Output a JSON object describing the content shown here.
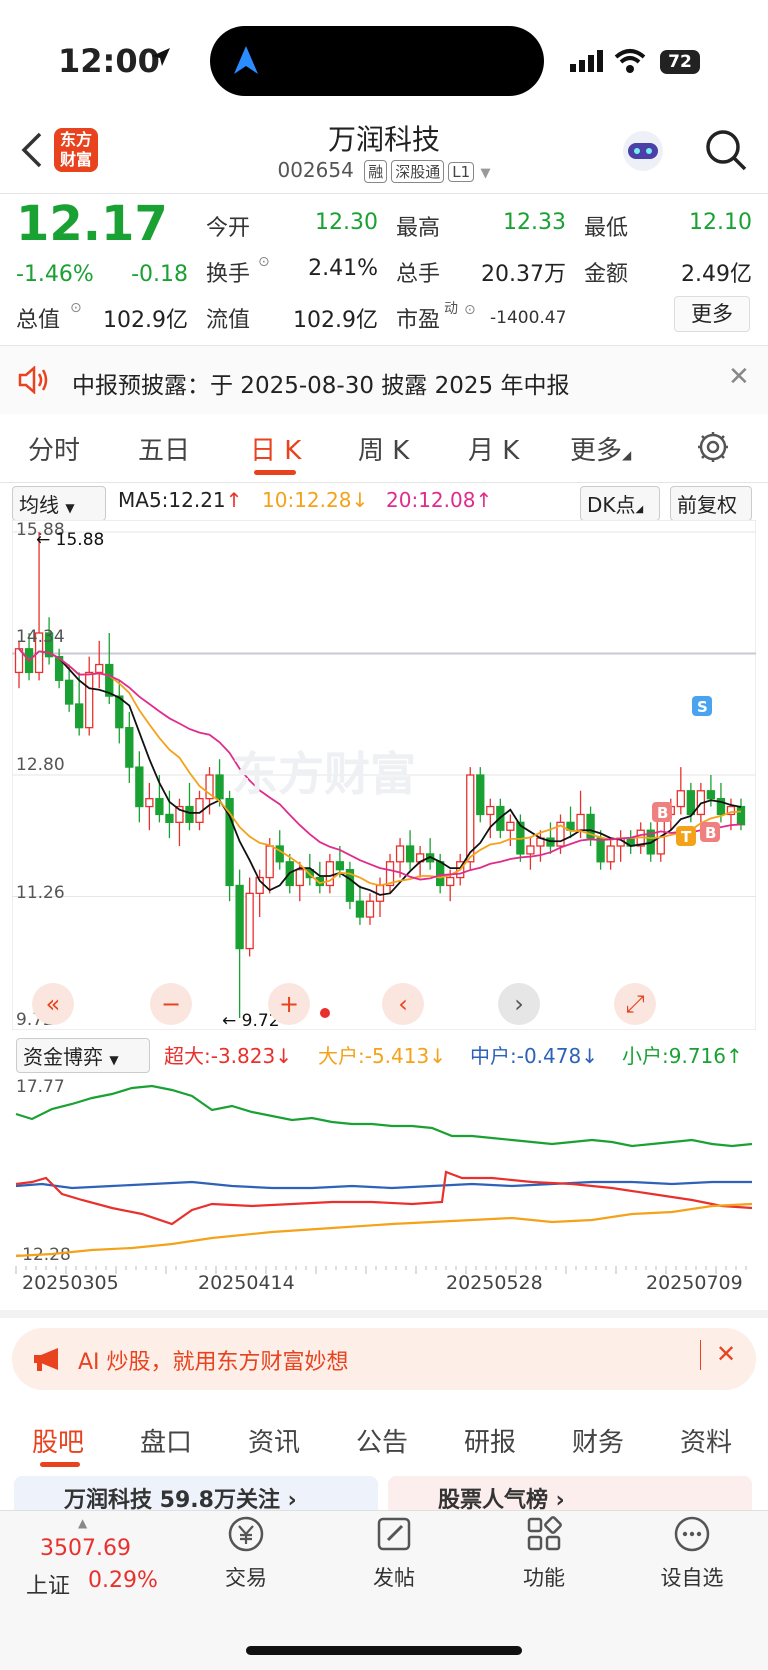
{
  "status_bar": {
    "time": "12:00",
    "battery": "72"
  },
  "header": {
    "logo_text": "东方\n财富",
    "title": "万润科技",
    "code": "002654",
    "tags": [
      "融",
      "深股通",
      "L1"
    ]
  },
  "quote": {
    "price": "12.17",
    "change_pct": "-1.46%",
    "change": "-0.18",
    "open_label": "今开",
    "open": "12.30",
    "high_label": "最高",
    "high": "12.33",
    "low_label": "最低",
    "low": "12.10",
    "turnover_label": "换手",
    "turnover": "2.41%",
    "volume_label": "总手",
    "volume": "20.37万",
    "amount_label": "金额",
    "amount": "2.49亿",
    "mktcap_label": "总值",
    "mktcap": "102.9亿",
    "float_label": "流值",
    "float": "102.9亿",
    "pe_label": "市盈",
    "pe_sup": "动",
    "pe": "-1400.47",
    "more_label": "更多"
  },
  "notice": {
    "text": "中报预披露：于 2025-08-30 披露 2025 年中报"
  },
  "period_tabs": [
    "分时",
    "五日",
    "日 K",
    "周 K",
    "月 K",
    "更多"
  ],
  "active_tab": "日 K",
  "chart_toolbar": {
    "ma_select": "均线",
    "ma5": "MA5:12.21",
    "ma10": "10:12.28",
    "ma20": "20:12.08",
    "dk_label": "DK点",
    "adjust_label": "前复权"
  },
  "chart_data": {
    "type": "candlestick",
    "y_labels": [
      "15.88",
      "14.34",
      "12.80",
      "11.26",
      "9.72"
    ],
    "max_label": "15.88",
    "min_label": "9.72",
    "ylim": [
      9.72,
      15.88
    ],
    "ma_colors": {
      "ma5": "#111111",
      "ma10": "#f4a21a",
      "ma20": "#e02b8d"
    },
    "markers": [
      "S",
      "B",
      "T",
      "B"
    ],
    "candles": [
      [
        14.1,
        14.5,
        13.9,
        14.4
      ],
      [
        14.4,
        14.6,
        14.0,
        14.1
      ],
      [
        14.1,
        15.88,
        14.0,
        14.6
      ],
      [
        14.6,
        14.8,
        14.2,
        14.3
      ],
      [
        14.3,
        14.4,
        13.9,
        14.0
      ],
      [
        14.0,
        14.2,
        13.6,
        13.7
      ],
      [
        13.7,
        14.1,
        13.3,
        13.4
      ],
      [
        13.4,
        14.3,
        13.3,
        14.1
      ],
      [
        14.1,
        14.5,
        13.9,
        14.2
      ],
      [
        14.2,
        14.6,
        13.7,
        13.8
      ],
      [
        13.8,
        14.0,
        13.2,
        13.4
      ],
      [
        13.4,
        13.6,
        12.7,
        12.9
      ],
      [
        12.9,
        13.1,
        12.2,
        12.4
      ],
      [
        12.4,
        12.7,
        12.1,
        12.5
      ],
      [
        12.5,
        12.8,
        12.2,
        12.3
      ],
      [
        12.3,
        12.6,
        12.0,
        12.2
      ],
      [
        12.2,
        12.5,
        11.9,
        12.4
      ],
      [
        12.4,
        12.7,
        12.1,
        12.2
      ],
      [
        12.2,
        12.6,
        12.1,
        12.5
      ],
      [
        12.5,
        12.9,
        12.3,
        12.8
      ],
      [
        12.8,
        13.0,
        12.4,
        12.5
      ],
      [
        12.5,
        12.6,
        11.2,
        11.4
      ],
      [
        11.4,
        11.6,
        9.72,
        10.6
      ],
      [
        10.6,
        11.5,
        10.5,
        11.3
      ],
      [
        11.3,
        11.6,
        11.0,
        11.5
      ],
      [
        11.5,
        12.0,
        11.3,
        11.9
      ],
      [
        11.9,
        12.1,
        11.6,
        11.7
      ],
      [
        11.7,
        11.8,
        11.3,
        11.4
      ],
      [
        11.4,
        11.7,
        11.2,
        11.6
      ],
      [
        11.6,
        11.8,
        11.4,
        11.5
      ],
      [
        11.5,
        11.7,
        11.3,
        11.4
      ],
      [
        11.4,
        11.8,
        11.3,
        11.7
      ],
      [
        11.7,
        11.9,
        11.5,
        11.6
      ],
      [
        11.6,
        11.7,
        11.1,
        11.2
      ],
      [
        11.2,
        11.4,
        10.9,
        11.0
      ],
      [
        11.0,
        11.3,
        10.9,
        11.2
      ],
      [
        11.2,
        11.5,
        11.0,
        11.4
      ],
      [
        11.4,
        11.8,
        11.3,
        11.7
      ],
      [
        11.7,
        12.0,
        11.5,
        11.9
      ],
      [
        11.9,
        12.1,
        11.6,
        11.7
      ],
      [
        11.7,
        11.9,
        11.5,
        11.8
      ],
      [
        11.8,
        12.0,
        11.6,
        11.7
      ],
      [
        11.7,
        11.8,
        11.3,
        11.4
      ],
      [
        11.4,
        11.6,
        11.2,
        11.5
      ],
      [
        11.5,
        11.8,
        11.4,
        11.7
      ],
      [
        11.7,
        12.9,
        11.6,
        12.8
      ],
      [
        12.8,
        12.9,
        12.2,
        12.3
      ],
      [
        12.3,
        12.5,
        12.0,
        12.4
      ],
      [
        12.4,
        12.5,
        12.0,
        12.1
      ],
      [
        12.1,
        12.3,
        11.9,
        12.2
      ],
      [
        12.2,
        12.3,
        11.7,
        11.8
      ],
      [
        11.8,
        12.0,
        11.6,
        11.9
      ],
      [
        11.9,
        12.1,
        11.7,
        12.0
      ],
      [
        12.0,
        12.2,
        11.8,
        11.9
      ],
      [
        11.9,
        12.3,
        11.8,
        12.2
      ],
      [
        12.2,
        12.4,
        12.0,
        12.1
      ],
      [
        12.1,
        12.6,
        12.0,
        12.3
      ],
      [
        12.3,
        12.4,
        11.9,
        12.0
      ],
      [
        12.0,
        12.1,
        11.6,
        11.7
      ],
      [
        11.7,
        12.0,
        11.6,
        11.9
      ],
      [
        11.9,
        12.1,
        11.7,
        12.0
      ],
      [
        12.0,
        12.1,
        11.8,
        11.9
      ],
      [
        11.9,
        12.2,
        11.8,
        12.1
      ],
      [
        12.1,
        12.2,
        11.7,
        11.8
      ],
      [
        11.8,
        12.4,
        11.7,
        12.3
      ],
      [
        12.3,
        12.5,
        12.1,
        12.4
      ],
      [
        12.4,
        12.9,
        12.3,
        12.6
      ],
      [
        12.6,
        12.7,
        12.2,
        12.3
      ],
      [
        12.3,
        12.7,
        12.2,
        12.6
      ],
      [
        12.6,
        12.8,
        12.4,
        12.5
      ],
      [
        12.5,
        12.7,
        12.2,
        12.3
      ],
      [
        12.3,
        12.5,
        12.1,
        12.4
      ],
      [
        12.4,
        12.5,
        12.1,
        12.17
      ]
    ]
  },
  "nav_buttons": [
    "«",
    "−",
    "+",
    "‹",
    "›",
    "⤢"
  ],
  "fund_panel": {
    "select": "资金博弈",
    "super_large": "超大:-3.823",
    "large": "大户:-5.413",
    "medium": "中户:-0.478",
    "small": "小户:9.716",
    "y_top": "17.77",
    "y_bottom": "-12.28",
    "dates": [
      "20250305",
      "20250414",
      "20250528",
      "20250709"
    ]
  },
  "ad_banner": {
    "text": "AI 炒股，就用东方财富妙想"
  },
  "bottom_tabs": [
    "股吧",
    "盘口",
    "资讯",
    "公告",
    "研报",
    "财务",
    "资料"
  ],
  "active_bottom_tab": "股吧",
  "peek_cards": [
    "万润科技 59.8万关注 ›",
    "股票人气榜 ›"
  ],
  "toolbar": {
    "index_value": "3507.69",
    "index_name": "上证",
    "index_change": "0.29%",
    "items": [
      "交易",
      "发帖",
      "功能",
      "设自选"
    ]
  },
  "colors": {
    "up": "#e8312d",
    "down": "#1aa133",
    "brand": "#e8421f"
  }
}
